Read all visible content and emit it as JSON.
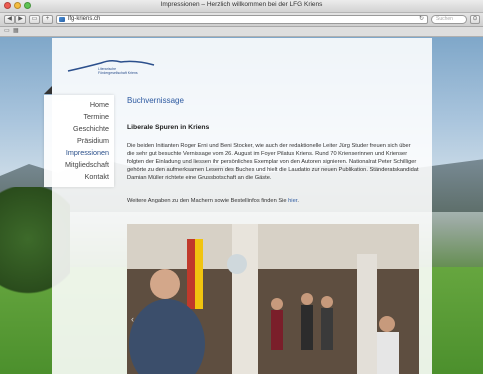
{
  "browser": {
    "title": "Impressionen – Herzlich willkommen bei der LFG Kriens",
    "url": "lfg-kriens.ch",
    "search_placeholder": "Suchen",
    "traffic_lights": [
      "#ee5b52",
      "#f5bd3f",
      "#5ec453"
    ]
  },
  "site": {
    "logo_line1": "Literarische",
    "logo_line2": "Fördergesellschaft Kriens",
    "nav": [
      {
        "label": "Home",
        "active": false
      },
      {
        "label": "Termine",
        "active": false
      },
      {
        "label": "Geschichte",
        "active": false
      },
      {
        "label": "Präsidium",
        "active": false
      },
      {
        "label": "Impressionen",
        "active": true
      },
      {
        "label": "Mitgliedschaft",
        "active": false
      },
      {
        "label": "Kontakt",
        "active": false
      }
    ],
    "section_title": "Buchvernissage",
    "article_title": "Liberale Spuren in Kriens",
    "body": "Die beiden Initianten Roger Erni und Beni Stocker, wie auch der redaktionelle Leiter Jürg Studer freuen sich über die sehr gut besuchte Vernissage vom 26. August im Foyer Pilatus Kriens. Rund 70 Krienserinnen und Krienser folgten der Einladung und liessen ihr persönliches Exemplar von den Autoren signieren. Nationalrat Peter Schilliger gehörte zu den aufmerksamen Lesern des Buches und hielt die Laudatio zur neuen Publikation. Ständeratskandidat Damian Müller richtete eine Grussbotschaft an die Gäste.",
    "more_prefix": "Weitere Angaben zu den Machern sowie Bestellinfos finden Sie ",
    "more_link": "hier",
    "more_suffix": ".",
    "slider_prev": "‹"
  },
  "colors": {
    "accent": "#2d5aa0"
  }
}
